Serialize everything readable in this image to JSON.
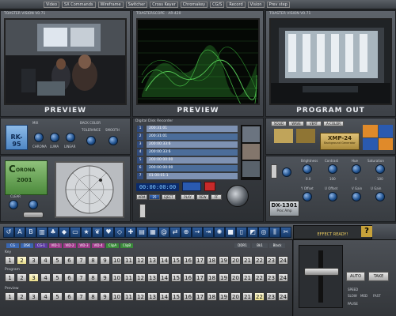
{
  "menubar": {
    "items": [
      "Video",
      "SX Commands",
      "Wireframe",
      "Switcher",
      "Cross Keyer",
      "Chromakey",
      "CG/S",
      "Record",
      "Vision",
      "Prev step"
    ]
  },
  "monitors": {
    "preview1": {
      "title": "TOASTER VISION V0.71",
      "label": "PREVIEW"
    },
    "preview2": {
      "title": "TOASTERSCOPE · AR-420",
      "label": "PREVIEW"
    },
    "program": {
      "title": "TOASTER VISION V0.71",
      "label": "PROGRAM OUT"
    }
  },
  "controls": {
    "keyer_name": "RK-95",
    "keyer_mix": "MIX",
    "keyer_color": "BACK COLOR",
    "keyer_labels": [
      "CHROMA",
      "LUMA",
      "LINEAR"
    ],
    "tolerance": "TOLERANCE",
    "smooth": "SMOOTH",
    "corona_line1": "C",
    "corona_line2": "ORONA",
    "corona_num": "2001",
    "clear": "CLEAR",
    "next_label": "NEXT",
    "recorder_title": "Digital Disk Recorder",
    "recorder_slots": [
      {
        "num": "1",
        "text": "200:31:01"
      },
      {
        "num": "2",
        "text": "200:31:01"
      },
      {
        "num": "3",
        "text": "200:00:33:6"
      },
      {
        "num": "4",
        "text": "200:00:33:6"
      },
      {
        "num": "5",
        "text": "200:00:00:00"
      },
      {
        "num": "6",
        "text": "200:00:00:00"
      },
      {
        "num": "7",
        "text": "01:00:01:1"
      }
    ],
    "timecode": "00:00:00:00",
    "rec_buttons": [
      "ARM",
      "25",
      "EJECT",
      "PLAY",
      "REW",
      "FF"
    ],
    "vtr_name": "XMP-24",
    "vtr_sub": "Background Generator",
    "vtr_btns": [
      "SOLID",
      "WAVE",
      "VERT",
      "A-COLOR"
    ],
    "proc_name": "DX-1301",
    "proc_sub": "Proc Amp",
    "proc_labels": [
      "Brightness",
      "Contrast",
      "Hue",
      "Saturation"
    ],
    "proc_labels2": [
      "Y Offset",
      "U Offset",
      "V Gain",
      "U Gain"
    ],
    "proc_values": [
      "0.0",
      "100",
      "0",
      "100"
    ],
    "effect_ready": "EFFECT READY!"
  },
  "toolbar": {
    "icons": [
      "arrow-icon",
      "a-icon",
      "b-icon",
      "wipe-icon",
      "tree-icon",
      "fish-icon",
      "rect-icon",
      "star-icon",
      "leaf-icon",
      "heart-icon",
      "diamond-icon",
      "cross-icon",
      "bars-icon",
      "grid-icon",
      "swirl-icon",
      "flip-icon",
      "zoom-icon",
      "push-icon",
      "slide-icon",
      "spin-icon",
      "cube-icon",
      "page-icon",
      "fold-icon",
      "ring-icon",
      "split-icon",
      "cut-icon"
    ]
  },
  "switcher": {
    "top_tabs": [
      "CG",
      "DSK",
      "CG-1",
      "VID-1",
      "VID-2",
      "VID-3",
      "VID-4",
      "ClipA",
      "ClipB"
    ],
    "row_labels": [
      "Key",
      "Program",
      "Preview"
    ],
    "numbers": [
      "1",
      "2",
      "3",
      "4",
      "5",
      "6",
      "7",
      "8",
      "9",
      "10",
      "11",
      "12",
      "13",
      "14",
      "15",
      "16",
      "17",
      "18",
      "19",
      "20",
      "21",
      "22",
      "23",
      "24"
    ],
    "active": {
      "key": "2",
      "program": "3",
      "preview": "22"
    },
    "mid_tabs": [
      "DDR1",
      "Bk1",
      "Black"
    ]
  },
  "transition": {
    "labels": [
      "AUTO",
      "TAKE"
    ],
    "speed_label": "SPEED",
    "speed_values": [
      "SLOW",
      "MED",
      "FAST"
    ],
    "pause_label": "PAUSE"
  }
}
